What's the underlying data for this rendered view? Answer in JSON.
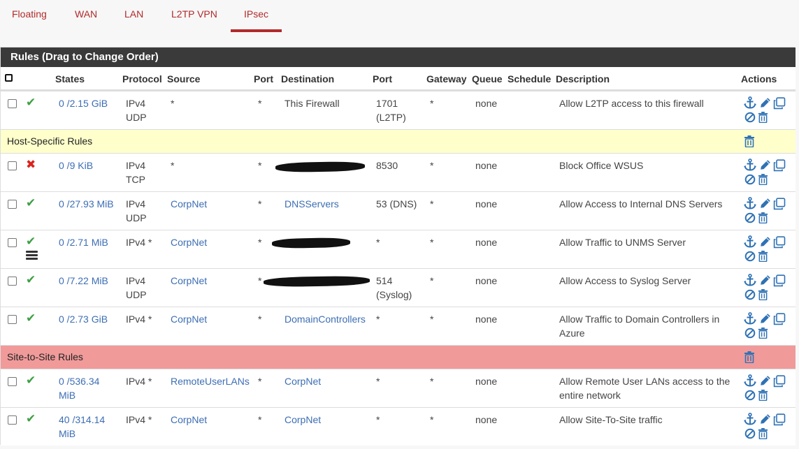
{
  "tabs": [
    "Floating",
    "WAN",
    "LAN",
    "L2TP VPN",
    "IPsec"
  ],
  "active_tab": "IPsec",
  "panel": {
    "title": "Rules (Drag to Change Order)"
  },
  "columns": [
    "States",
    "Protocol",
    "Source",
    "Port",
    "Destination",
    "Port",
    "Gateway",
    "Queue",
    "Schedule",
    "Description",
    "Actions"
  ],
  "colors": {
    "accent": "#b22a2a",
    "link": "#3c6eb4",
    "pass": "#3ea043",
    "block": "#d9251d",
    "host_separator": "#ffffcc",
    "site_separator": "#f09a9a",
    "header": "#3a3a3a"
  },
  "icons": {
    "pass": "check-icon",
    "block": "times-icon",
    "schedule": "schedule-icon",
    "actions": [
      "anchor-icon",
      "pencil-icon",
      "copy-icon",
      "ban-icon",
      "trash-icon"
    ]
  },
  "rule_top": {
    "status": "pass",
    "states": "0 /2.15 GiB",
    "protocol": [
      "IPv4",
      "UDP"
    ],
    "source": "*",
    "source_port": "*",
    "destination": "This Firewall",
    "dest_port": [
      "1701",
      "(L2TP)"
    ],
    "gateway": "*",
    "queue": "none",
    "schedule": "",
    "description": "Allow L2TP access to this firewall"
  },
  "sep_host": {
    "label": "Host-Specific Rules"
  },
  "host_rules": [
    {
      "status": "block",
      "states": "0 /9 KiB",
      "protocol": [
        "IPv4",
        "TCP"
      ],
      "source": "*",
      "source_port": "*",
      "destination": "",
      "dest_port": "8530",
      "gateway": "*",
      "queue": "none",
      "description": "Block Office WSUS"
    },
    {
      "status": "pass",
      "states": "0 /27.93 MiB",
      "protocol": [
        "IPv4",
        "UDP"
      ],
      "source": "CorpNet",
      "source_port": "*",
      "destination": "DNSServers",
      "dest_port": "53 (DNS)",
      "gateway": "*",
      "queue": "none",
      "description": "Allow Access to Internal DNS Servers"
    },
    {
      "status": "pass",
      "states": "0 /2.71 MiB",
      "protocol": [
        "IPv4 *",
        ""
      ],
      "source": "CorpNet",
      "source_port": "*",
      "destination": "",
      "dest_port": "*",
      "gateway": "*",
      "queue": "none",
      "description": "Allow Traffic to UNMS Server"
    },
    {
      "status": "pass",
      "states": "0 /7.22 MiB",
      "protocol": [
        "IPv4",
        "UDP"
      ],
      "source": "CorpNet",
      "source_port": "*",
      "destination": "",
      "dest_port": "514",
      "dest_port2": "(Syslog)",
      "gateway": "*",
      "queue": "none",
      "description": "Allow Access to Syslog Server"
    },
    {
      "status": "pass",
      "states": "0 /2.73 GiB",
      "protocol": [
        "IPv4 *",
        ""
      ],
      "source": "CorpNet",
      "source_port": "*",
      "destination": "DomainControllers",
      "dest_port": "*",
      "gateway": "*",
      "queue": "none",
      "description": "Allow Traffic to Domain Controllers in Azure"
    }
  ],
  "sep_site": {
    "label": "Site-to-Site Rules"
  },
  "site_rules": [
    {
      "status": "pass",
      "states": "0 /536.34 MiB",
      "protocol": "IPv4 *",
      "source": "RemoteUserLANs",
      "source_port": "*",
      "destination": "CorpNet",
      "dest_port": "*",
      "gateway": "*",
      "queue": "none",
      "description": "Allow Remote User LANs access to the entire network"
    },
    {
      "status": "pass",
      "states": "40 /314.14 MiB",
      "protocol": "IPv4 *",
      "source": "CorpNet",
      "source_port": "*",
      "destination": "CorpNet",
      "dest_port": "*",
      "gateway": "*",
      "queue": "none",
      "description": "Allow Site-To-Site traffic"
    }
  ]
}
